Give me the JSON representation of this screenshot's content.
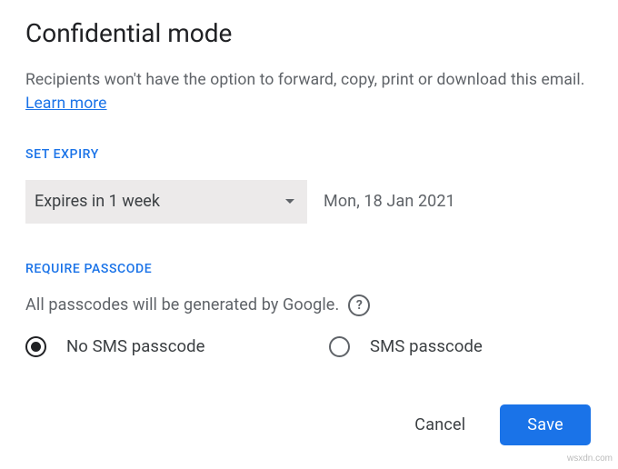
{
  "dialog": {
    "title": "Confidential mode",
    "description_pre": "Recipients won't have the option to forward, copy, print or download this email. ",
    "learn_more": "Learn more"
  },
  "expiry": {
    "section_label": "SET EXPIRY",
    "selected": "Expires in 1 week",
    "date": "Mon, 18 Jan 2021"
  },
  "passcode": {
    "section_label": "REQUIRE PASSCODE",
    "description": "All passcodes will be generated by Google.",
    "help_glyph": "?",
    "options": {
      "no_sms": "No SMS passcode",
      "sms": "SMS passcode"
    },
    "selected": "no_sms"
  },
  "buttons": {
    "cancel": "Cancel",
    "save": "Save"
  },
  "watermark": "wsxdn.com"
}
